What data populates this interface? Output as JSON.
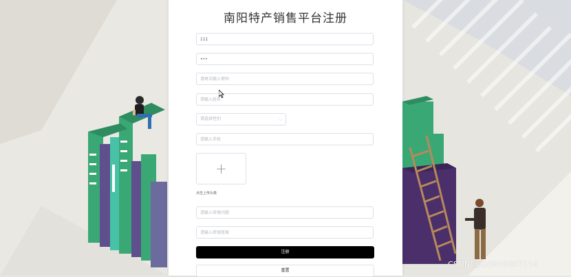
{
  "page": {
    "title": "南阳特产销售平台注册"
  },
  "form": {
    "username_value": "111",
    "password_value": "•••",
    "confirm_password_placeholder": "请再次输入密码",
    "name_placeholder": "请输入姓名",
    "gender_placeholder": "请选择性别",
    "phone_placeholder": "请输入手机",
    "avatar_upload_label": "点击上传头像",
    "security_question_placeholder": "请输入密保问题",
    "security_answer_placeholder": "请输入密保答案",
    "upload_plus_icon": "+",
    "select_chevron_icon": "⌵"
  },
  "buttons": {
    "register_label": "注册",
    "reset_label": "重置"
  },
  "watermark": {
    "text": "CSDN @QQ849807118"
  },
  "colors": {
    "book_green": "#3aa875",
    "book_purple": "#5f4f8c",
    "book_teal": "#48c2a7",
    "primary_button": "#000000"
  }
}
